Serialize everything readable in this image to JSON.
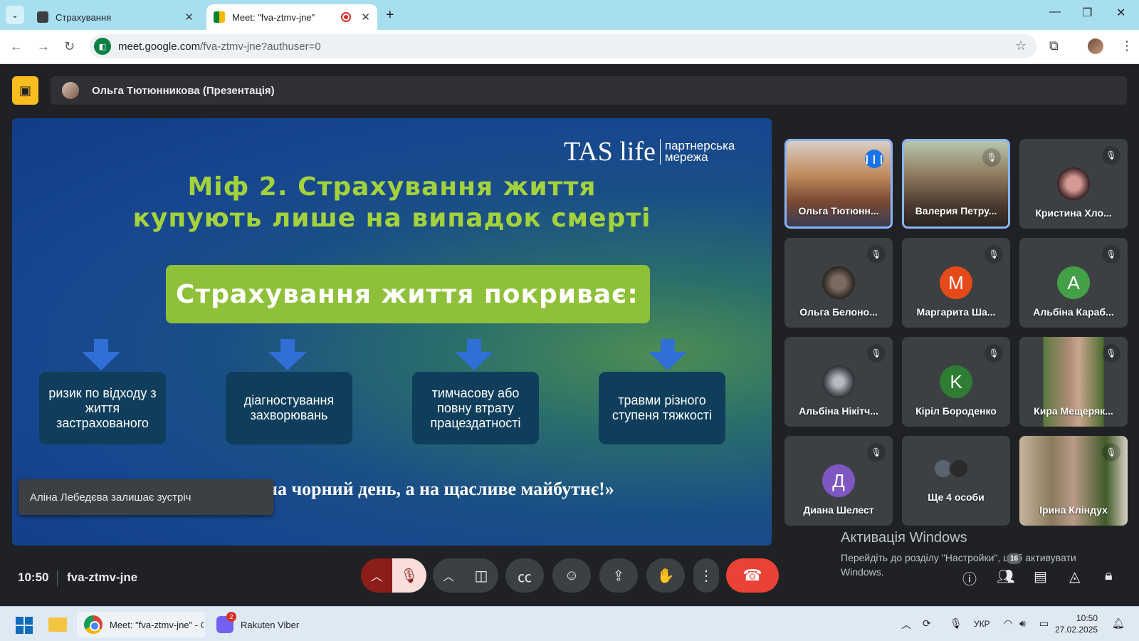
{
  "browser": {
    "tabs": [
      {
        "title": "Страхування",
        "close": "✕"
      },
      {
        "title": "Meet: \"fva-ztmv-jne\"",
        "close": "✕"
      }
    ],
    "new_tab": "+",
    "window_controls": [
      "—",
      "❐",
      "✕"
    ],
    "url_host": "meet.google.com",
    "url_path": "/fva-ztmv-jne?authuser=0"
  },
  "meet": {
    "presenter": "Ольга Тютюнникова (Презентація)",
    "slide": {
      "logo_main": "TAS life",
      "logo_sub_1": "партнерська",
      "logo_sub_2": "мережа",
      "title_line_1": "Міф 2. Страхування життя",
      "title_line_2": "купують  лише на випадок смерті",
      "box": "Страхування життя покриває:",
      "cards": [
        "ризик по відходу з життя застрахованого",
        "діагностування захворювань",
        "тимчасову або повну втрату працездатності",
        "травми різного ступеня тяжкості"
      ],
      "quote": "на чорний день, а на щасливе майбутнє!»"
    },
    "toast": "Аліна Лебедєва залишає зустріч",
    "participants": [
      {
        "name": "Ольга Тютюнн...",
        "avatar": ""
      },
      {
        "name": "Валерия Петру...",
        "avatar": ""
      },
      {
        "name": "Кристина Хло...",
        "avatar": ""
      },
      {
        "name": "Ольга Белоно...",
        "avatar": ""
      },
      {
        "name": "Маргарита Ша...",
        "avatar": "М"
      },
      {
        "name": "Альбіна Караб...",
        "avatar": "А"
      },
      {
        "name": "Альбіна Нікітч...",
        "avatar": ""
      },
      {
        "name": "Кіріл Бороденко",
        "avatar": "K"
      },
      {
        "name": "Кира Мещеряк...",
        "avatar": ""
      },
      {
        "name": "Диана Шелест",
        "avatar": "Д"
      },
      {
        "name": "Ще 4 особи",
        "avatar": ""
      },
      {
        "name": "Ірина Кліндух",
        "avatar": ""
      }
    ],
    "windows_activation_title": "Активація Windows",
    "windows_activation_text": "Перейдіть до розділу \"Настройки\", щоб активувати Windows.",
    "time": "10:50",
    "meeting_code": "fva-ztmv-jne",
    "participants_count": "16",
    "colors": {
      "end_call": "#ea4335",
      "mic_muted_bg": "#f9dedc",
      "avatar_m": "#e64a19",
      "avatar_a": "#43a047",
      "avatar_k": "#2e7d32",
      "avatar_d": "#7e57c2"
    }
  },
  "taskbar": {
    "chrome_label": "Meet: \"fva-ztmv-jne\" - G",
    "viber_label": "Rakuten Viber",
    "viber_badge": "2",
    "lang": "УКР",
    "time": "10:50",
    "date": "27.02.2025"
  }
}
